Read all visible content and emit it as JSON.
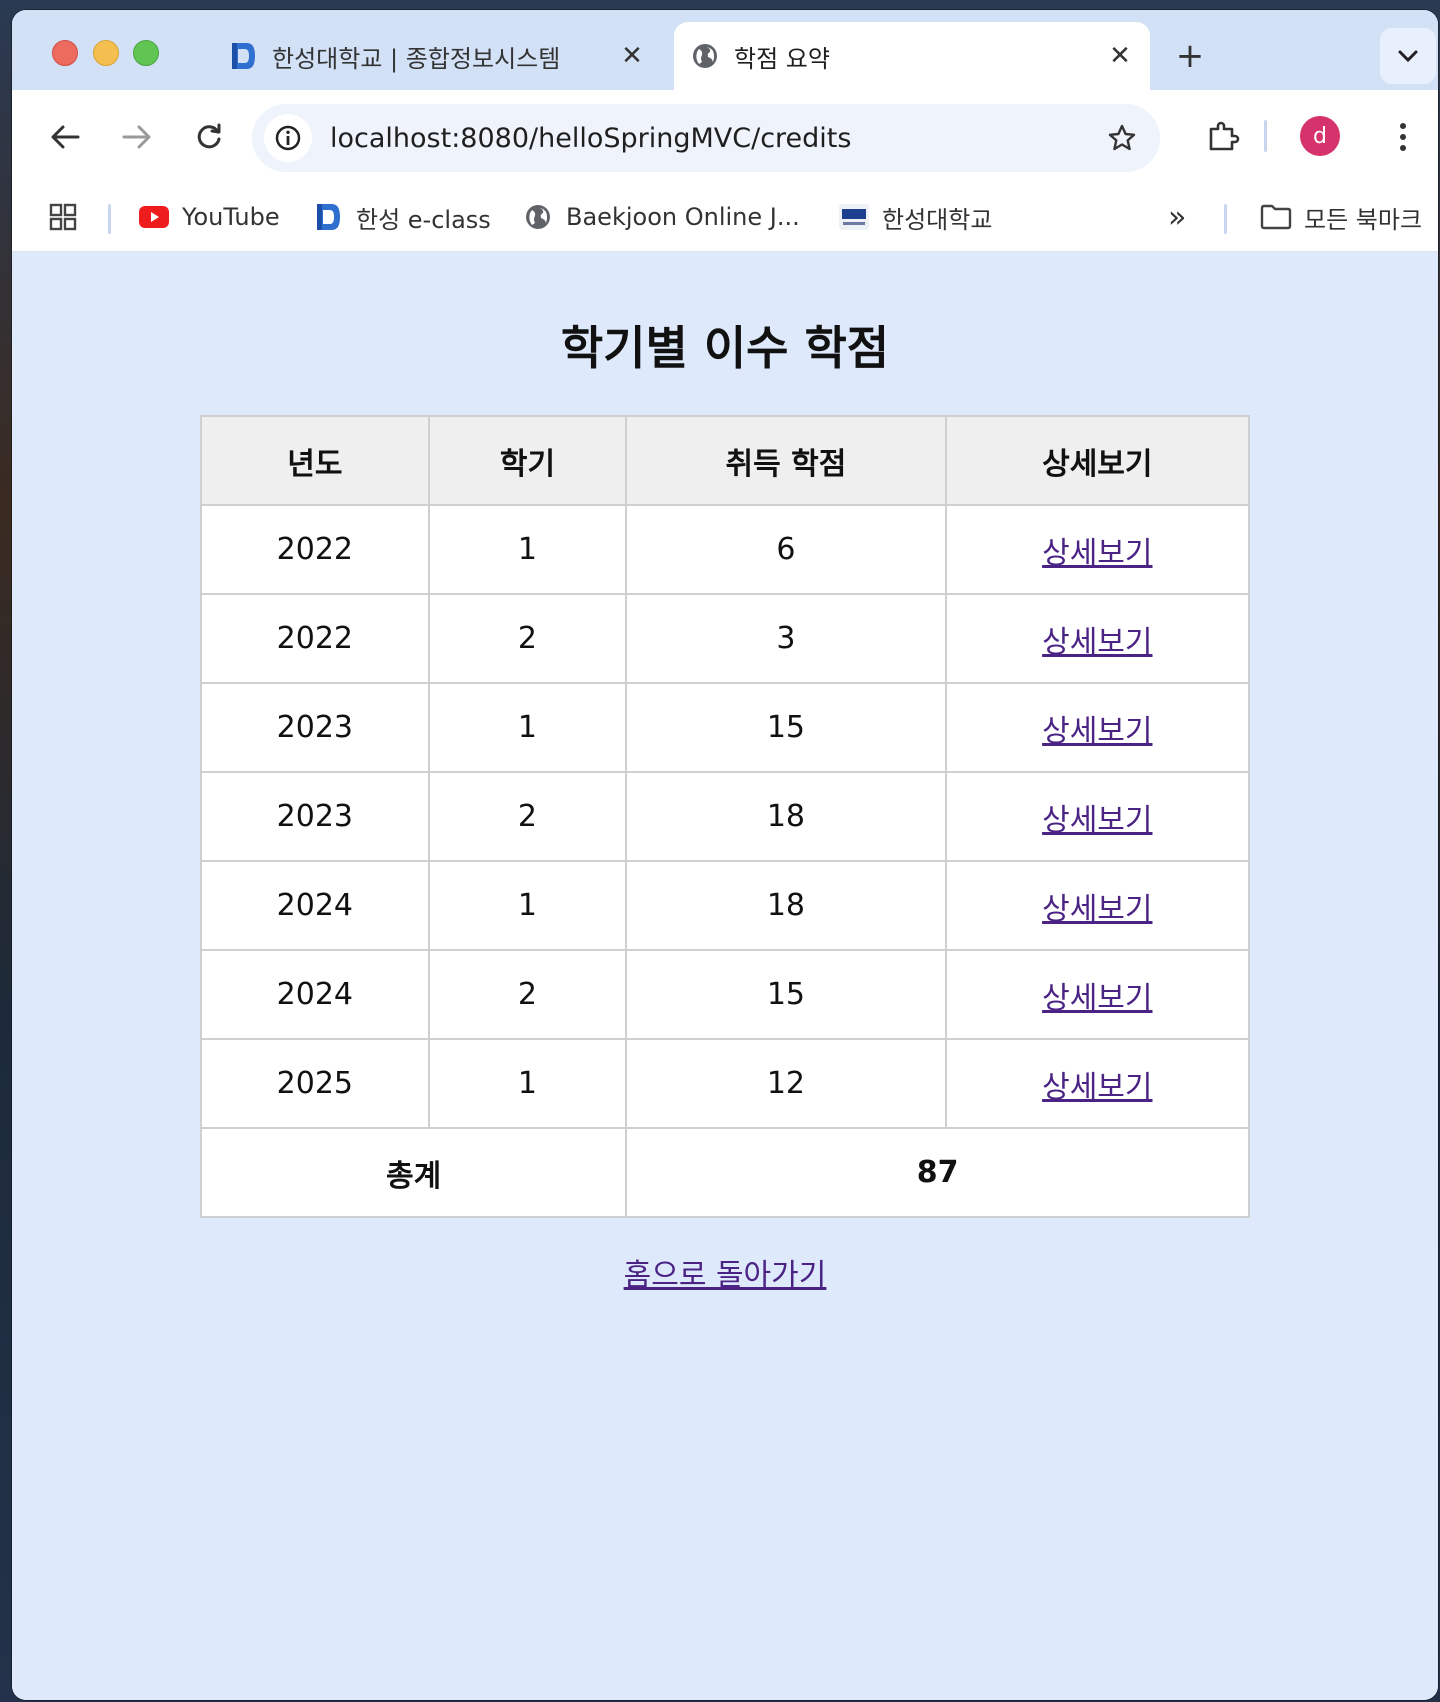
{
  "browser": {
    "tabs": [
      {
        "title": "한성대학교 | 종합정보시스템",
        "active": false
      },
      {
        "title": "학점 요약",
        "active": true
      }
    ],
    "close_glyph": "✕",
    "new_tab_glyph": "+",
    "url": "localhost:8080/helloSpringMVC/credits",
    "avatar_letter": "d",
    "avatar_color": "#d6336c",
    "bookmarks": [
      {
        "label": "YouTube",
        "icon": "youtube-icon"
      },
      {
        "label": "한성 e-class",
        "icon": "eclass-icon"
      },
      {
        "label": "Baekjoon Online J...",
        "icon": "globe-icon"
      },
      {
        "label": "한성대학교",
        "icon": "hsu-logo-icon"
      }
    ],
    "all_bookmarks_label": "모든 북마크",
    "more_bookmarks_glyph": "»"
  },
  "page": {
    "title": "학기별 이수 학점",
    "table": {
      "headers": [
        "년도",
        "학기",
        "취득 학점",
        "상세보기"
      ],
      "rows": [
        {
          "year": "2022",
          "semester": "1",
          "credits": "6",
          "detail": "상세보기"
        },
        {
          "year": "2022",
          "semester": "2",
          "credits": "3",
          "detail": "상세보기"
        },
        {
          "year": "2023",
          "semester": "1",
          "credits": "15",
          "detail": "상세보기"
        },
        {
          "year": "2023",
          "semester": "2",
          "credits": "18",
          "detail": "상세보기"
        },
        {
          "year": "2024",
          "semester": "1",
          "credits": "18",
          "detail": "상세보기"
        },
        {
          "year": "2024",
          "semester": "2",
          "credits": "15",
          "detail": "상세보기"
        },
        {
          "year": "2025",
          "semester": "1",
          "credits": "12",
          "detail": "상세보기"
        }
      ],
      "total_label": "총계",
      "total_value": "87"
    },
    "home_link": "홈으로 돌아가기",
    "colors": {
      "background": "#deeafb",
      "link": "#4b2385",
      "header_bg": "#efefef"
    }
  }
}
